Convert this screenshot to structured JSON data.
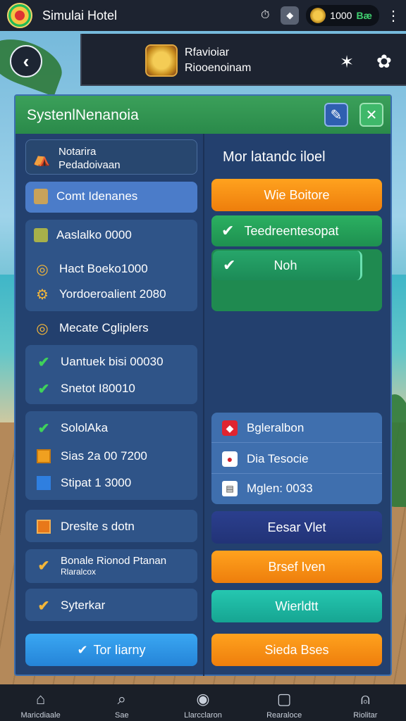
{
  "app": {
    "title": "Simulai Hotel"
  },
  "topbar": {
    "coins": "1000",
    "coin_unit": "Bæ"
  },
  "header": {
    "line1": "Rfavioiar",
    "line2": "Riooenoinam"
  },
  "panel": {
    "title": "SystenlNenanoia",
    "left": {
      "profile": {
        "name": "Notarira",
        "subtitle": "Pedadoivaan"
      },
      "selected_item": "Comt Idenanes",
      "stats": [
        {
          "icon": "box-icon",
          "label": "Aaslalko 0000"
        },
        {
          "icon": "coin-icon",
          "label": "Hact Boeko1000"
        },
        {
          "icon": "gear-icon",
          "label": "Yordoeroalient 2080"
        }
      ],
      "section_label": "Mecate Cgliplers",
      "checks_a": [
        "Uantuek bisi 00030",
        "Snetot I80010"
      ],
      "checks_b": [
        {
          "icon": "check-icon",
          "label": "SololAka"
        },
        {
          "icon": "square-orange-icon",
          "label": "Sias 2a 00 7200"
        },
        {
          "icon": "square-blue-icon",
          "label": "Stipat 1 3000"
        }
      ],
      "option1": "Dreslte s dotn",
      "option2_line1": "Bonale Rionod Ptanan",
      "option2_line2": "Rlaralcox",
      "option3": "Syterkar",
      "confirm_button": "Tor Iiarny"
    },
    "right": {
      "heading": "Mor latandc iloel",
      "btn_orange": "Wie Boitore",
      "btn_green": "Teedreentesopat",
      "btn_selected": "Noh",
      "list": [
        {
          "icon": "red-flag-icon",
          "label": "Bgleralbon"
        },
        {
          "icon": "red-dice-icon",
          "label": "Dia Tesocie"
        },
        {
          "icon": "document-icon",
          "label": "Mglen: 0033"
        }
      ],
      "btn_navy": "Eesar Vlet",
      "btn_orange2": "Brsef Iven",
      "btn_teal": "Wierldtt",
      "btn_orange3": "Sieda Bses"
    }
  },
  "bottom_nav": [
    {
      "icon": "home-icon",
      "label": "Maricdiaale"
    },
    {
      "icon": "search-icon",
      "label": "Sae"
    },
    {
      "icon": "camera-icon",
      "label": "Llarcclaron"
    },
    {
      "icon": "square-icon",
      "label": "Rearaloce"
    },
    {
      "icon": "person-icon",
      "label": "Riolitar"
    }
  ]
}
